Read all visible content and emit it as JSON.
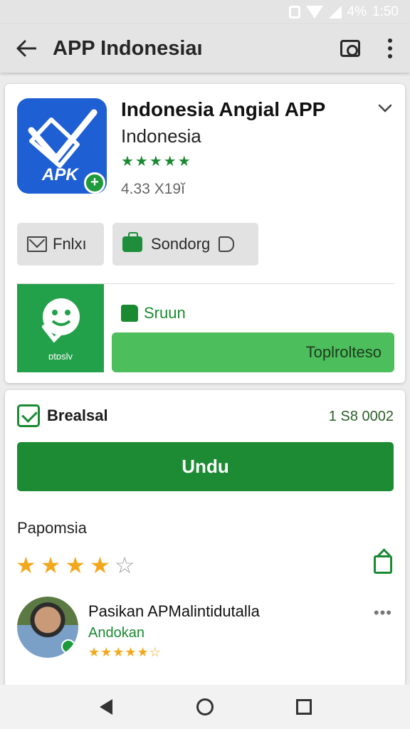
{
  "status_bar": {
    "battery": "4%",
    "time": "1:50"
  },
  "app_bar": {
    "title": "APP Indonesiaı",
    "back_icon": "arrow-left-icon",
    "camera_icon": "camera-icon",
    "more_icon": "more-vert-icon"
  },
  "app_info": {
    "icon_text": "APK",
    "name": "Indonesia Angial APP",
    "developer": "Indonesia",
    "stars": "★★★★★",
    "rating_text": "4.33 X19ĭ",
    "chips": [
      {
        "label": "Fnlxı",
        "icon": "mail-icon"
      },
      {
        "label": "Sondorg",
        "icon": "bag-icon"
      }
    ]
  },
  "promo": {
    "icon_label": "ɒtɒslv",
    "like_label": "Sruun",
    "button_label": "Toplrolteso"
  },
  "download_section": {
    "header": "Brealsal",
    "count": "1 S8 0002",
    "button_label": "Undu"
  },
  "rating_section": {
    "title": "Papomsia",
    "user_rating": 3.5,
    "stars": [
      "★",
      "★",
      "★",
      "★",
      "☆"
    ]
  },
  "review": {
    "name": "Pasikan APMalintidutalla",
    "subtitle": "Andokan",
    "stars": "★★★★★☆",
    "more": "•••"
  },
  "colors": {
    "accent_green": "#1d8a34",
    "light_green": "#4cbf5c",
    "blue_icon": "#1e5fd4",
    "star_yellow": "#f2a81c"
  }
}
